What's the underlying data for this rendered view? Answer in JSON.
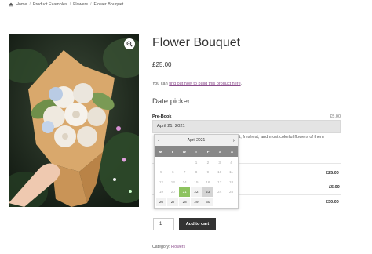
{
  "breadcrumb": {
    "items": [
      "Home",
      "Product Examples",
      "Flowers",
      "Flower Bouquet"
    ],
    "separator": "/"
  },
  "product": {
    "title": "Flower Bouquet",
    "price": "£25.00",
    "description_prefix": "You can ",
    "description_link": "find out how to build this product here",
    "description_suffix": "."
  },
  "date_picker": {
    "heading": "Date picker",
    "field_label": "Pre-Book",
    "field_cost": "£5.00",
    "selected_date": "April 21, 2021",
    "partially_hidden_text": "st, freshest, and most colorful flowers of them"
  },
  "calendar": {
    "month_label": "April 2021",
    "prev_icon": "‹",
    "next_icon": "›",
    "weekdays": [
      "M",
      "T",
      "W",
      "T",
      "F",
      "S",
      "S"
    ],
    "weeks": [
      [
        "",
        "",
        "",
        "1",
        "2",
        "3",
        "4"
      ],
      [
        "5",
        "6",
        "7",
        "8",
        "9",
        "10",
        "11"
      ],
      [
        "12",
        "13",
        "14",
        "15",
        "16",
        "17",
        "18"
      ],
      [
        "19",
        "20",
        "21",
        "22",
        "23",
        "24",
        "25"
      ],
      [
        "26",
        "27",
        "28",
        "29",
        "30",
        "",
        ""
      ]
    ],
    "today": "21",
    "selected": "23",
    "available": [
      "21",
      "22",
      "23",
      "26",
      "27",
      "28",
      "29",
      "30"
    ]
  },
  "totals": {
    "rows": [
      "£25.00",
      "£5.00",
      "£30.00"
    ]
  },
  "cart": {
    "quantity": "1",
    "button_label": "Add to cart"
  },
  "category": {
    "label": "Category: ",
    "link": "Flowers"
  },
  "colors": {
    "link": "#8a4b8b",
    "today_highlight": "#8dc35f",
    "button_bg": "#333333",
    "weekday_bar": "#888888"
  },
  "icons": {
    "home": "home-icon",
    "zoom": "magnifier-plus-icon"
  }
}
